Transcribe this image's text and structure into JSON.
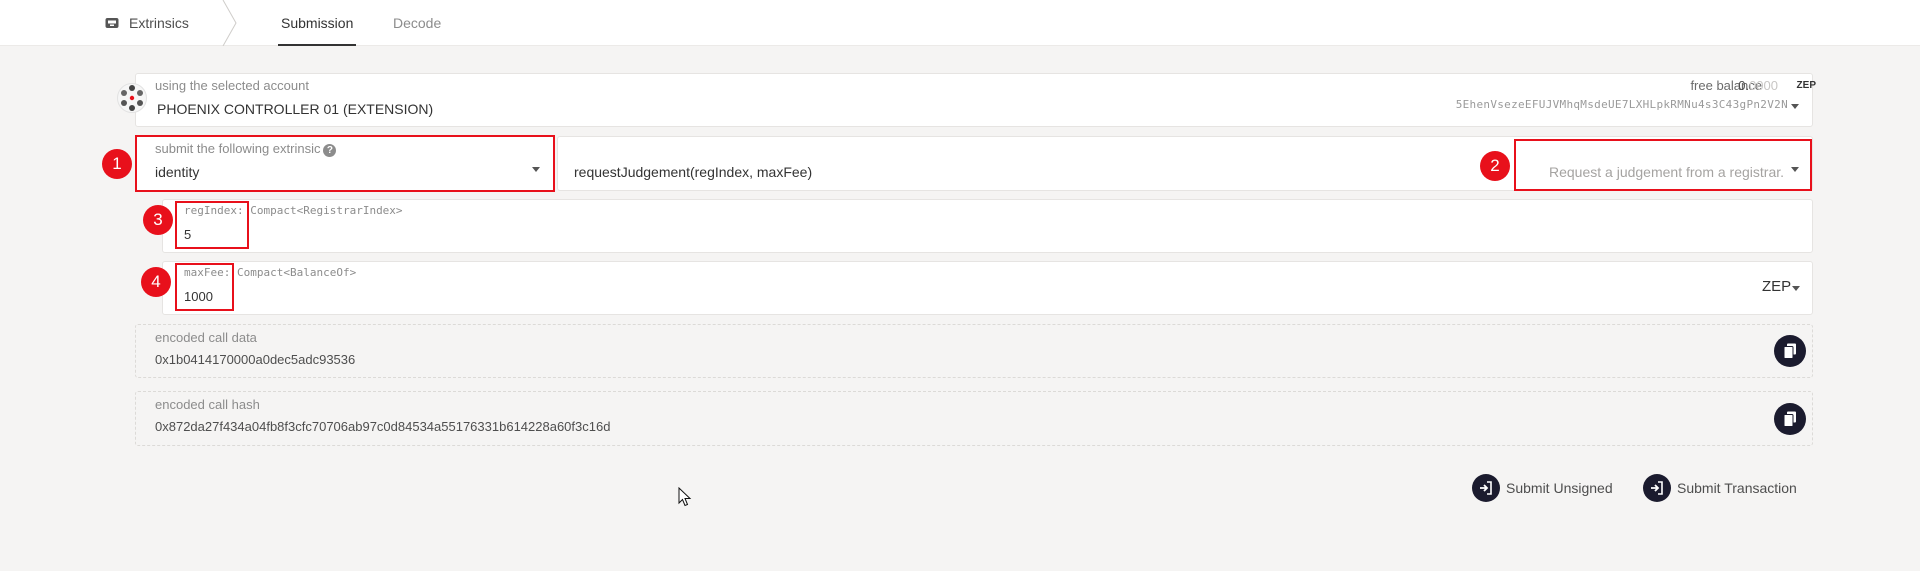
{
  "nav": {
    "section_label": "Extrinsics",
    "tabs": [
      {
        "label": "Submission",
        "active": true
      },
      {
        "label": "Decode",
        "active": false
      }
    ]
  },
  "account": {
    "label": "using the selected account",
    "name": "PHOENIX CONTROLLER 01 (EXTENSION)",
    "free_balance_label": "free balance",
    "free_balance_value": "0.",
    "free_balance_decimals": "0000",
    "free_balance_unit": "ZEP",
    "address": "5EhenVsezeEFUJVMhqMsdeUE7LXHLpkRMNu4s3C43gPn2V2N"
  },
  "extrinsic": {
    "label": "submit the following extrinsic",
    "help_glyph": "?",
    "module": "identity",
    "method": "requestJudgement(regIndex, maxFee)",
    "method_description": "Request a judgement from a registrar."
  },
  "params": [
    {
      "name": "regIndex:",
      "type": "Compact<RegistrarIndex>",
      "value": "5"
    },
    {
      "name": "maxFee:",
      "type": "Compact<BalanceOf>",
      "value": "1000",
      "unit": "ZEP"
    }
  ],
  "encoded": {
    "call_data_label": "encoded call data",
    "call_data": "0x1b0414170000a0dec5adc93536",
    "call_hash_label": "encoded call hash",
    "call_hash": "0x872da27f434a04fb8f3cfc70706ab97c0d84534a55176331b614228a60f3c16d"
  },
  "annotations": [
    "1",
    "2",
    "3",
    "4"
  ],
  "actions": {
    "submit_unsigned": "Submit Unsigned",
    "submit_transaction": "Submit Transaction"
  },
  "colors": {
    "annotation_red": "#e8101b",
    "button_dark": "#1b1b2e",
    "page_bg": "#f5f4f3"
  }
}
